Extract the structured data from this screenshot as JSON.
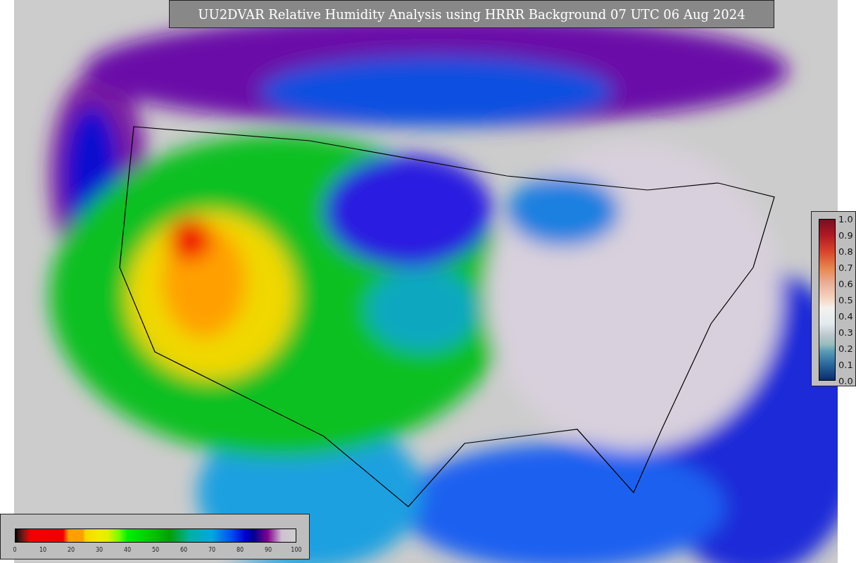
{
  "title": "UU2DVAR Relative Humidity Analysis using HRRR Background 07 UTC 06 Aug 2024",
  "humidity_colorbar": {
    "ticks": [
      "0",
      "10",
      "20",
      "30",
      "40",
      "50",
      "60",
      "70",
      "80",
      "90",
      "100"
    ]
  },
  "observation_colorbar": {
    "ticks": [
      "1.0",
      "0.9",
      "0.8",
      "0.7",
      "0.6",
      "0.5",
      "0.4",
      "0.3",
      "0.2",
      "0.1",
      "0.0"
    ]
  }
}
